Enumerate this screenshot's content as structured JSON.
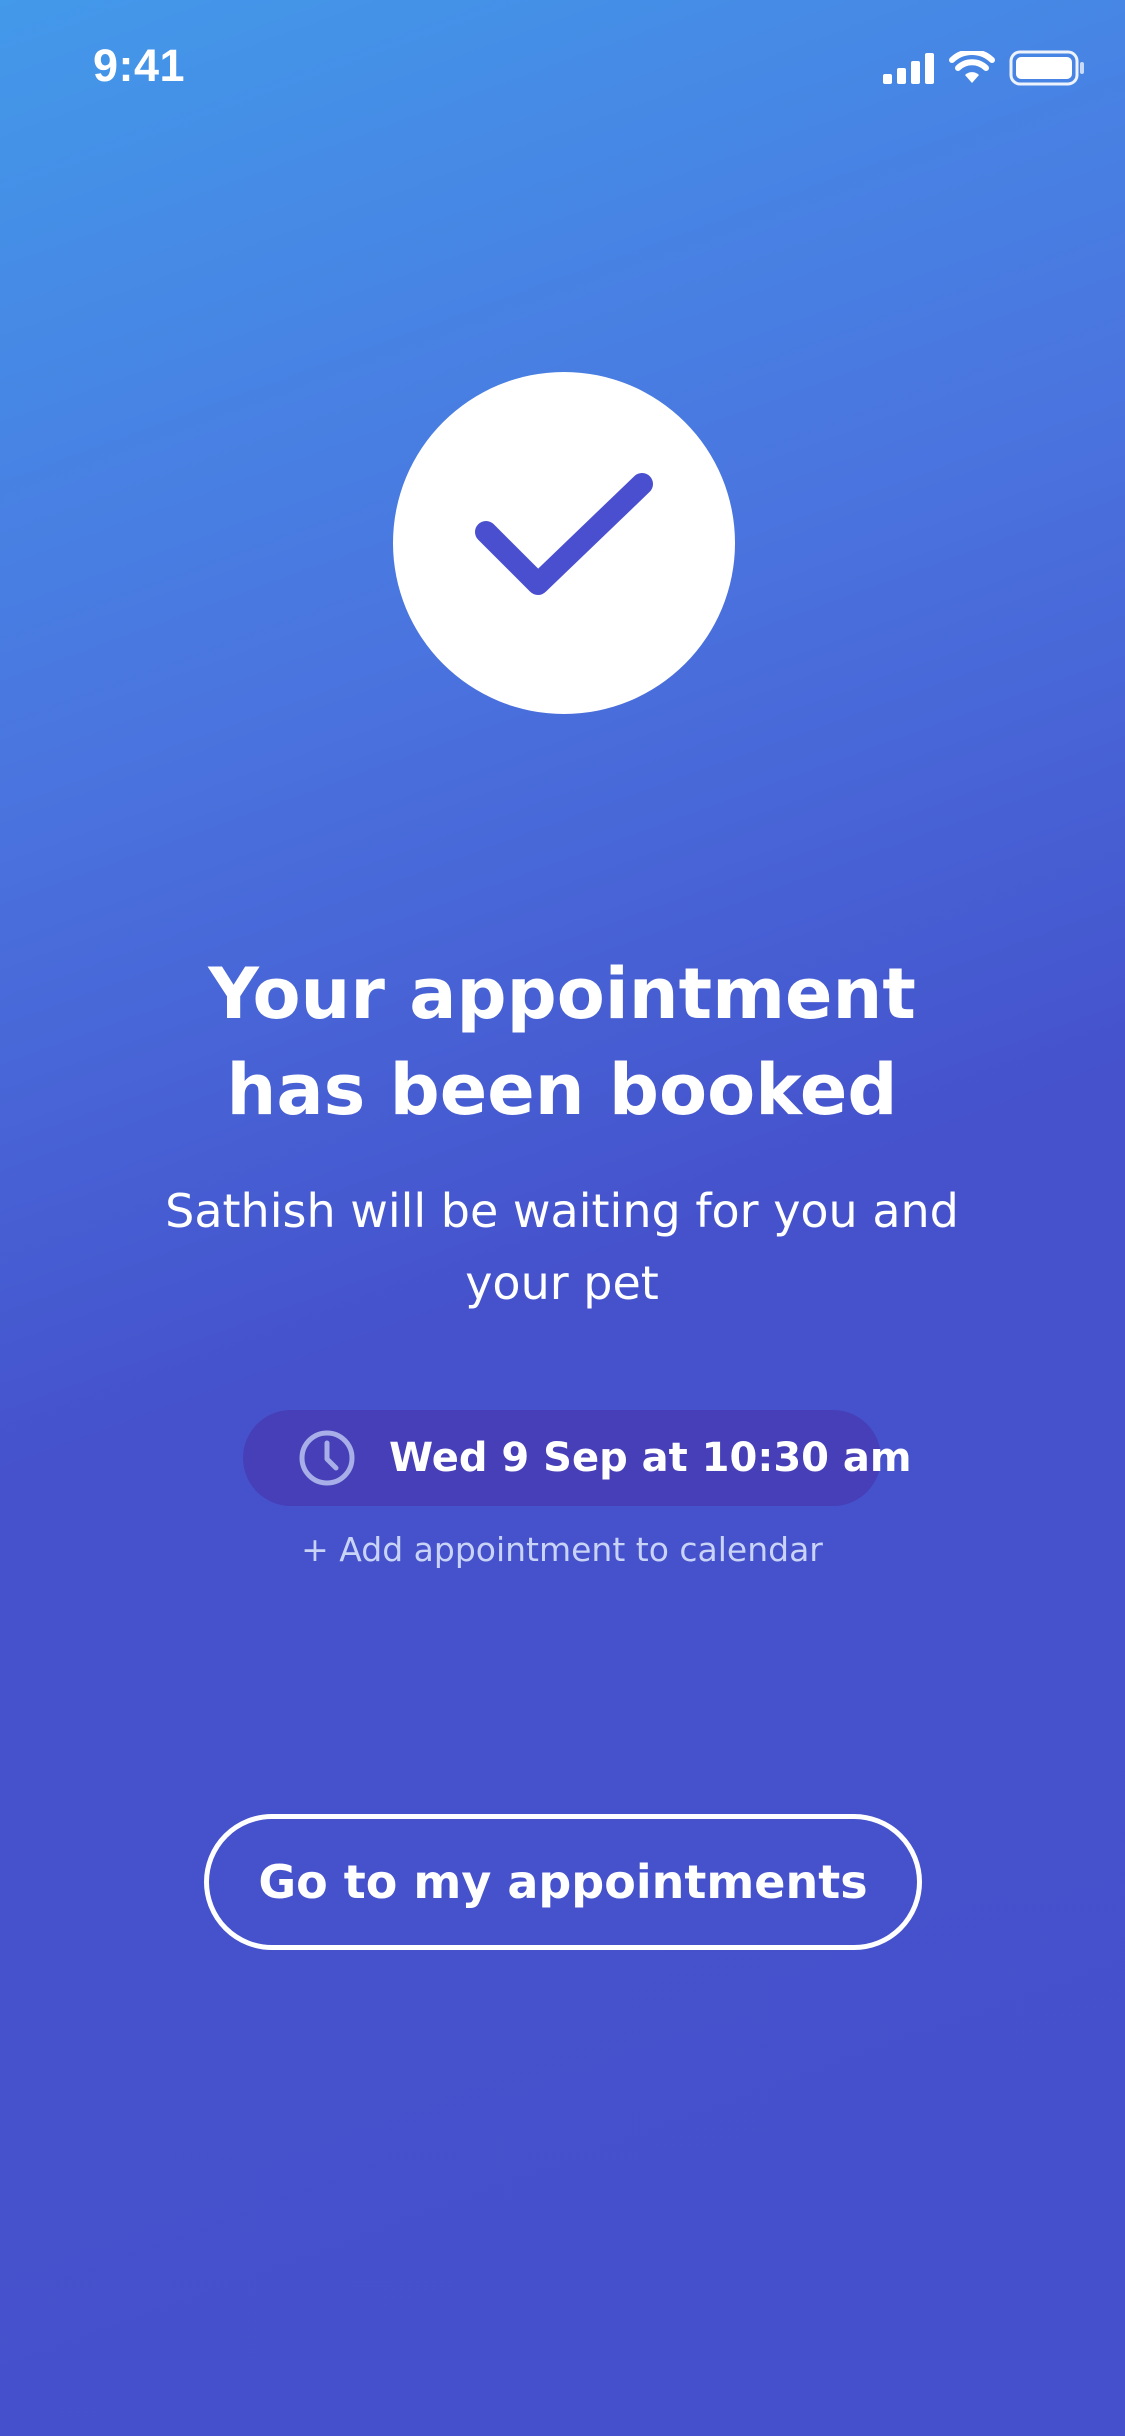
{
  "status_bar": {
    "time": "9:41",
    "icons": [
      "cellular-signal-icon",
      "wifi-icon",
      "battery-icon"
    ]
  },
  "confirmation": {
    "icon": "checkmark-icon",
    "title_line_1": "Your appointment",
    "title_line_2": "has been booked",
    "subtitle_line_1": "Sathish will be waiting for you and",
    "subtitle_line_2": "your pet"
  },
  "appointment": {
    "icon": "clock-icon",
    "datetime": "Wed 9 Sep at 10:30 am",
    "add_to_calendar_label": "+ Add appointment to calendar"
  },
  "actions": {
    "primary_label": "Go to my appointments"
  },
  "colors": {
    "gradient_start": "#4399ea",
    "gradient_end": "#4551cc",
    "pill_background": "#473fb8",
    "check_color": "#4a4fd0",
    "text": "#ffffff",
    "link_text": "#c9d3f5"
  }
}
